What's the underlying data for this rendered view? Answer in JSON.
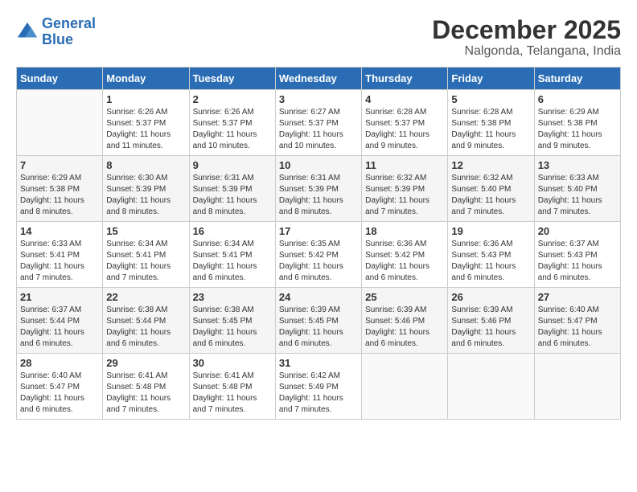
{
  "header": {
    "logo_line1": "General",
    "logo_line2": "Blue",
    "month": "December 2025",
    "location": "Nalgonda, Telangana, India"
  },
  "days_of_week": [
    "Sunday",
    "Monday",
    "Tuesday",
    "Wednesday",
    "Thursday",
    "Friday",
    "Saturday"
  ],
  "weeks": [
    [
      {
        "day": "",
        "info": ""
      },
      {
        "day": "1",
        "info": "Sunrise: 6:26 AM\nSunset: 5:37 PM\nDaylight: 11 hours\nand 11 minutes."
      },
      {
        "day": "2",
        "info": "Sunrise: 6:26 AM\nSunset: 5:37 PM\nDaylight: 11 hours\nand 10 minutes."
      },
      {
        "day": "3",
        "info": "Sunrise: 6:27 AM\nSunset: 5:37 PM\nDaylight: 11 hours\nand 10 minutes."
      },
      {
        "day": "4",
        "info": "Sunrise: 6:28 AM\nSunset: 5:37 PM\nDaylight: 11 hours\nand 9 minutes."
      },
      {
        "day": "5",
        "info": "Sunrise: 6:28 AM\nSunset: 5:38 PM\nDaylight: 11 hours\nand 9 minutes."
      },
      {
        "day": "6",
        "info": "Sunrise: 6:29 AM\nSunset: 5:38 PM\nDaylight: 11 hours\nand 9 minutes."
      }
    ],
    [
      {
        "day": "7",
        "info": "Sunrise: 6:29 AM\nSunset: 5:38 PM\nDaylight: 11 hours\nand 8 minutes."
      },
      {
        "day": "8",
        "info": "Sunrise: 6:30 AM\nSunset: 5:39 PM\nDaylight: 11 hours\nand 8 minutes."
      },
      {
        "day": "9",
        "info": "Sunrise: 6:31 AM\nSunset: 5:39 PM\nDaylight: 11 hours\nand 8 minutes."
      },
      {
        "day": "10",
        "info": "Sunrise: 6:31 AM\nSunset: 5:39 PM\nDaylight: 11 hours\nand 8 minutes."
      },
      {
        "day": "11",
        "info": "Sunrise: 6:32 AM\nSunset: 5:39 PM\nDaylight: 11 hours\nand 7 minutes."
      },
      {
        "day": "12",
        "info": "Sunrise: 6:32 AM\nSunset: 5:40 PM\nDaylight: 11 hours\nand 7 minutes."
      },
      {
        "day": "13",
        "info": "Sunrise: 6:33 AM\nSunset: 5:40 PM\nDaylight: 11 hours\nand 7 minutes."
      }
    ],
    [
      {
        "day": "14",
        "info": "Sunrise: 6:33 AM\nSunset: 5:41 PM\nDaylight: 11 hours\nand 7 minutes."
      },
      {
        "day": "15",
        "info": "Sunrise: 6:34 AM\nSunset: 5:41 PM\nDaylight: 11 hours\nand 7 minutes."
      },
      {
        "day": "16",
        "info": "Sunrise: 6:34 AM\nSunset: 5:41 PM\nDaylight: 11 hours\nand 6 minutes."
      },
      {
        "day": "17",
        "info": "Sunrise: 6:35 AM\nSunset: 5:42 PM\nDaylight: 11 hours\nand 6 minutes."
      },
      {
        "day": "18",
        "info": "Sunrise: 6:36 AM\nSunset: 5:42 PM\nDaylight: 11 hours\nand 6 minutes."
      },
      {
        "day": "19",
        "info": "Sunrise: 6:36 AM\nSunset: 5:43 PM\nDaylight: 11 hours\nand 6 minutes."
      },
      {
        "day": "20",
        "info": "Sunrise: 6:37 AM\nSunset: 5:43 PM\nDaylight: 11 hours\nand 6 minutes."
      }
    ],
    [
      {
        "day": "21",
        "info": "Sunrise: 6:37 AM\nSunset: 5:44 PM\nDaylight: 11 hours\nand 6 minutes."
      },
      {
        "day": "22",
        "info": "Sunrise: 6:38 AM\nSunset: 5:44 PM\nDaylight: 11 hours\nand 6 minutes."
      },
      {
        "day": "23",
        "info": "Sunrise: 6:38 AM\nSunset: 5:45 PM\nDaylight: 11 hours\nand 6 minutes."
      },
      {
        "day": "24",
        "info": "Sunrise: 6:39 AM\nSunset: 5:45 PM\nDaylight: 11 hours\nand 6 minutes."
      },
      {
        "day": "25",
        "info": "Sunrise: 6:39 AM\nSunset: 5:46 PM\nDaylight: 11 hours\nand 6 minutes."
      },
      {
        "day": "26",
        "info": "Sunrise: 6:39 AM\nSunset: 5:46 PM\nDaylight: 11 hours\nand 6 minutes."
      },
      {
        "day": "27",
        "info": "Sunrise: 6:40 AM\nSunset: 5:47 PM\nDaylight: 11 hours\nand 6 minutes."
      }
    ],
    [
      {
        "day": "28",
        "info": "Sunrise: 6:40 AM\nSunset: 5:47 PM\nDaylight: 11 hours\nand 6 minutes."
      },
      {
        "day": "29",
        "info": "Sunrise: 6:41 AM\nSunset: 5:48 PM\nDaylight: 11 hours\nand 7 minutes."
      },
      {
        "day": "30",
        "info": "Sunrise: 6:41 AM\nSunset: 5:48 PM\nDaylight: 11 hours\nand 7 minutes."
      },
      {
        "day": "31",
        "info": "Sunrise: 6:42 AM\nSunset: 5:49 PM\nDaylight: 11 hours\nand 7 minutes."
      },
      {
        "day": "",
        "info": ""
      },
      {
        "day": "",
        "info": ""
      },
      {
        "day": "",
        "info": ""
      }
    ]
  ]
}
